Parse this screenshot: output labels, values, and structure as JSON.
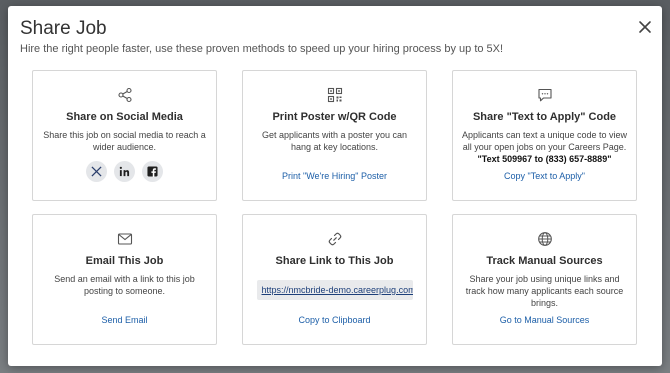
{
  "modal": {
    "title": "Share Job",
    "subtitle": "Hire the right people faster, use these proven methods to speed up your hiring process by up to 5X!"
  },
  "cards": {
    "social": {
      "icon": "share-icon",
      "title": "Share on Social Media",
      "desc": "Share this job on social media to reach a wider audience.",
      "buttons": [
        "x-twitter-icon",
        "linkedin-icon",
        "facebook-icon"
      ]
    },
    "poster": {
      "icon": "qr-code-icon",
      "title": "Print Poster w/QR Code",
      "desc": "Get applicants with a poster you can hang at key locations.",
      "link": "Print \"We're Hiring\" Poster"
    },
    "text_to_apply": {
      "icon": "chat-bubble-icon",
      "title": "Share \"Text to Apply\" Code",
      "desc": "Applicants can text a unique code to view all your open jobs on your Careers Page.",
      "code": "\"Text 509967 to (833) 657-8889\"",
      "link": "Copy \"Text to Apply\""
    },
    "email": {
      "icon": "envelope-icon",
      "title": "Email This Job",
      "desc": "Send an email with a link to this job posting to someone.",
      "link": "Send Email"
    },
    "share_link": {
      "icon": "link-icon",
      "title": "Share Link to This Job",
      "url": "https://nmcbride-demo.careerplug.com/jo",
      "link": "Copy to Clipboard"
    },
    "manual_sources": {
      "icon": "globe-icon",
      "title": "Track Manual Sources",
      "desc": "Share your job using unique links and track how many applicants each source brings.",
      "link": "Go to Manual Sources"
    }
  },
  "colors": {
    "link": "#1d5fa8",
    "title": "#333333",
    "border": "#d6d6d6"
  }
}
